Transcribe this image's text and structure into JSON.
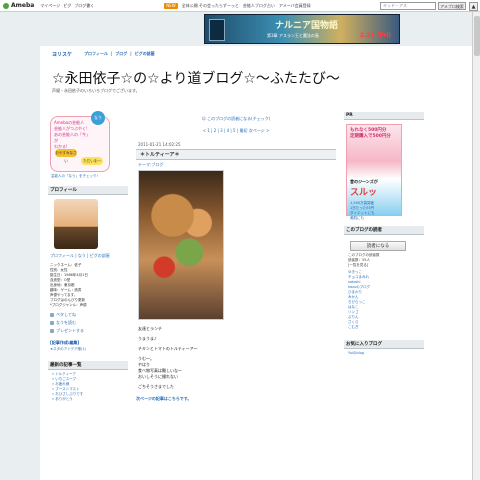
{
  "topbar": {
    "brand": "Ameba",
    "links": [
      "マイページ",
      "ピグ",
      "ブログ書く"
    ],
    "notices": [
      "NEW",
      "全体公開 その会ったらずーっと",
      "芸能人ブログ占い",
      "アメーバ会員登録"
    ],
    "search_placeholder": "キッド・アス",
    "login_label": "アメブロ検索"
  },
  "banner": {
    "title": "ナルニア国物語",
    "subtitle": "第3章 アスラン王と魔法の島",
    "date": "2.25 (Fri)"
  },
  "header": {
    "site_logo": "ヨリスケ",
    "nav": [
      "プロフィール",
      "ブログ",
      "ピグの部屋"
    ],
    "blog_title": "☆永田依子☆の☆より道ブログ☆〜ふたたび〜",
    "description": "声優・永田依子のいろいろブログでございます。"
  },
  "left": {
    "ad": {
      "circle": "なう",
      "question": "Amebaの芸能人\n芸能人がつぶやく!\nあの芸能人の「今」が\nわかる!",
      "btn1": "おやすみなさい",
      "btn2": "ただいま〜",
      "foot": "芸能人の「なう」をチェック!"
    },
    "profile_head": "プロフィール",
    "profile_links": "プロフィール | なう | ピグの部屋",
    "profile_info": "ニックネーム：依子\n性別：女性\n誕生日：1986年4月1日\n血液型：O型\n出身地：東京都\n趣味：ゲーム・読書\n声優やってます。\nブログはのんびり更新\n*ブログジャンル：声優",
    "side_links": [
      "ペタしてね",
      "なうを読む",
      "プレゼントする"
    ],
    "feature": "[記事作成:編集]",
    "feature_sub": "★ネタのアイデア帳(1)",
    "theme_head": "最新の記事一覧",
    "themes": [
      "トルティーア",
      "いちごスープ",
      "お疲れ様",
      "ブーストマスト",
      "おひさしぶりです",
      "ありがとう"
    ]
  },
  "center": {
    "reader_text": "このブログの読者になる(チェック)",
    "pager": "< 1 | 2 | 3 | 4 | 5 | 最初 次ページ >",
    "date": "2011-01-21 14:02:25",
    "post_title": "＊トルティーア＊",
    "theme": "テーマ:ブログ",
    "body": [
      "友達とランチ",
      "うまうま♪",
      "チキンとトマトのトルティーア〜",
      "うむ〜。\nやはり\n食べ物写真は難しいな〜\nおいしそうに撮れない",
      "ごちそうさまでした"
    ],
    "next": "次ページの記事はこちらです。"
  },
  "right": {
    "pr_head": "PR",
    "pr": {
      "l1": "もれなく500円分\n定期購入で500円分",
      "l2": "昔のジーンズが",
      "l3": "スルッ",
      "l4": "1,500万袋突破\n1日たった55円\nダイエットにも\n美肌にも"
    },
    "reader_head": "このブログの読者",
    "reader_btn": "読者になる",
    "reader_info": "このブログの読者数\n読者数：55人\n[一覧を見る]",
    "readers": [
      "ゆきっこ",
      "チョコまみれ",
      "satoshi",
      "kazuのブログ",
      "ひまわり",
      "みかん",
      "ちびらっこ",
      "はなこ",
      "リンゴ",
      "ぷりん",
      "さくら",
      "こむぎ"
    ],
    "friends_head": "お気に入りブログ",
    "friends_sub": "Yuiのblog"
  }
}
